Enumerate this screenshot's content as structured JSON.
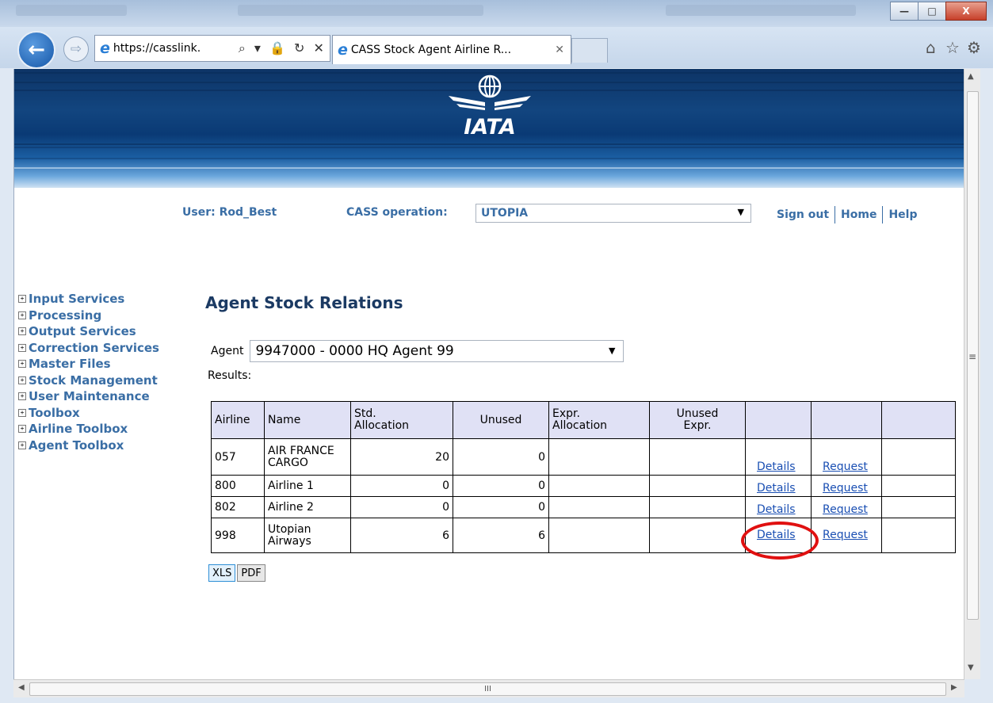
{
  "window": {
    "minimize": "—",
    "maximize": "□",
    "close": "X"
  },
  "browser": {
    "url": "https://casslink.",
    "address_tools": "⌕ ▾ 🔒 ↻ ✕",
    "tab_title": "CASS Stock Agent Airline R...",
    "tab_close": "✕",
    "icons": [
      "home-icon",
      "star-icon",
      "gear-icon"
    ]
  },
  "header": {
    "user_label": "User: Rod_Best",
    "cass_label": "CASS operation:",
    "cass_value": "UTOPIA",
    "links": [
      "Sign out",
      "Home",
      "Help"
    ],
    "logo_text": "IATA"
  },
  "nav": {
    "items": [
      "Input Services",
      "Processing",
      "Output Services",
      "Correction Services",
      "Master Files",
      "Stock Management",
      "User Maintenance",
      "Toolbox",
      "Airline Toolbox",
      "Agent Toolbox"
    ]
  },
  "main": {
    "title": "Agent Stock Relations",
    "agent_label": "Agent",
    "agent_value": "9947000 - 0000 HQ Agent 99",
    "results_label": "Results:",
    "table": {
      "headers": [
        "Airline",
        "Name",
        "Std.\nAllocation",
        "Unused",
        "Expr.\nAllocation",
        "Unused\nExpr.",
        "",
        "",
        ""
      ],
      "rows": [
        {
          "airline": "057",
          "name": "AIR FRANCE CARGO",
          "std": "20",
          "unused": "0",
          "expr": "",
          "unused_expr": "",
          "details": "Details",
          "request": "Request"
        },
        {
          "airline": "800",
          "name": "Airline 1",
          "std": "0",
          "unused": "0",
          "expr": "",
          "unused_expr": "",
          "details": "Details",
          "request": "Request"
        },
        {
          "airline": "802",
          "name": "Airline 2",
          "std": "0",
          "unused": "0",
          "expr": "",
          "unused_expr": "",
          "details": "Details",
          "request": "Request"
        },
        {
          "airline": "998",
          "name": "Utopian Airways",
          "std": "6",
          "unused": "6",
          "expr": "",
          "unused_expr": "",
          "details": "Details",
          "request": "Request"
        }
      ]
    },
    "export_buttons": [
      "XLS",
      "PDF"
    ],
    "highlight_color": "#e01010"
  },
  "scroll": {
    "hscroll_grip": "III"
  }
}
